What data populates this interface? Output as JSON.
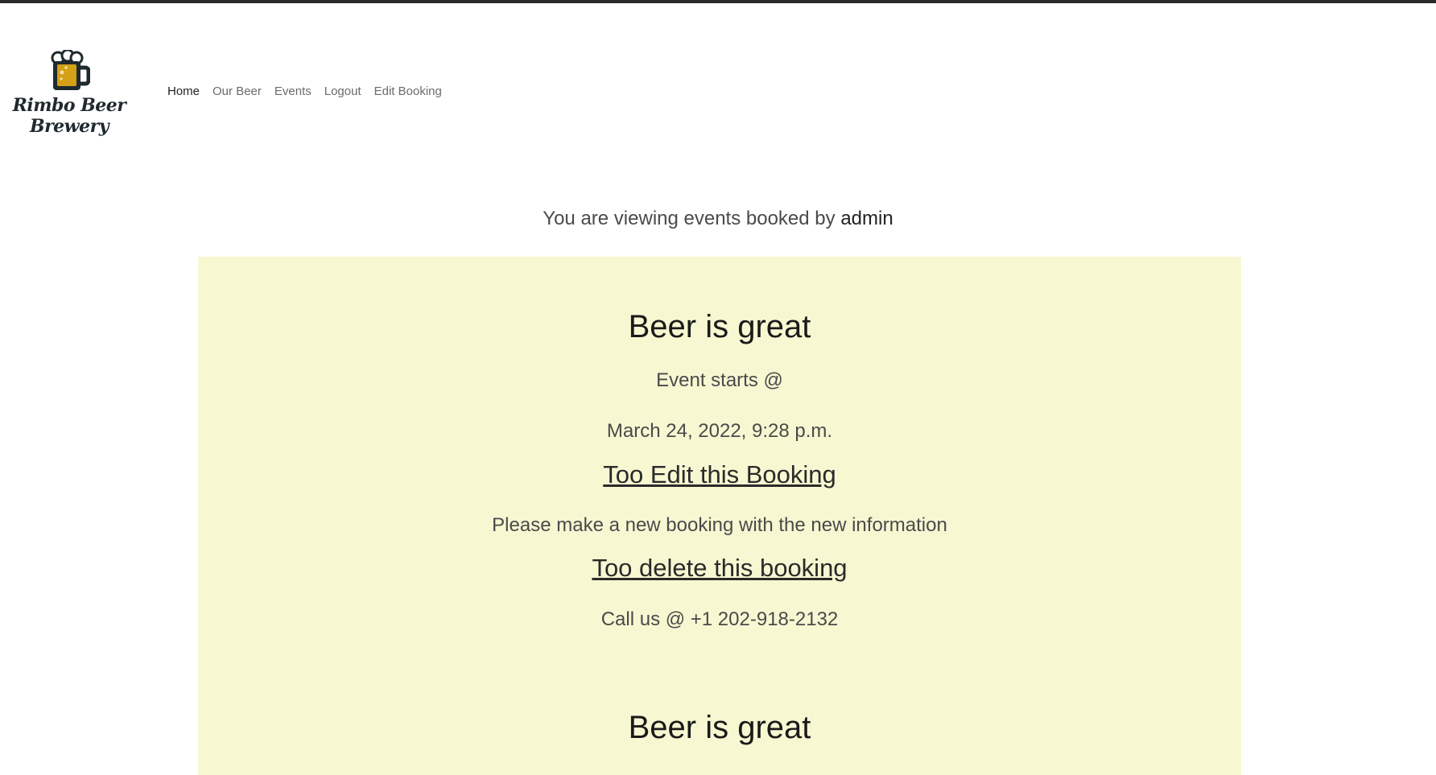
{
  "brand": {
    "line1": "Rimbo Beer",
    "line2": "Brewery",
    "icon": "beer-mug-icon",
    "icon_color": "#d4a017"
  },
  "nav": {
    "items": [
      "Home",
      "Our Beer",
      "Events",
      "Logout",
      "Edit Booking"
    ],
    "active": "Home"
  },
  "viewing": {
    "prefix": "You are viewing events booked by",
    "user": "admin"
  },
  "colors": {
    "panel_bg": "#f7f8d2",
    "topbar": "#2b2b2b"
  },
  "bookings": [
    {
      "title": "Beer is great",
      "starts_label": "Event starts @",
      "date": "March 24, 2022, 9:28 p.m.",
      "edit_link": "Too Edit this Booking",
      "edit_note": "Please make a new booking with the new information",
      "delete_link": "Too delete this booking",
      "call": "Call us @ +1 202-918-2132"
    },
    {
      "title": "Beer is great"
    }
  ]
}
